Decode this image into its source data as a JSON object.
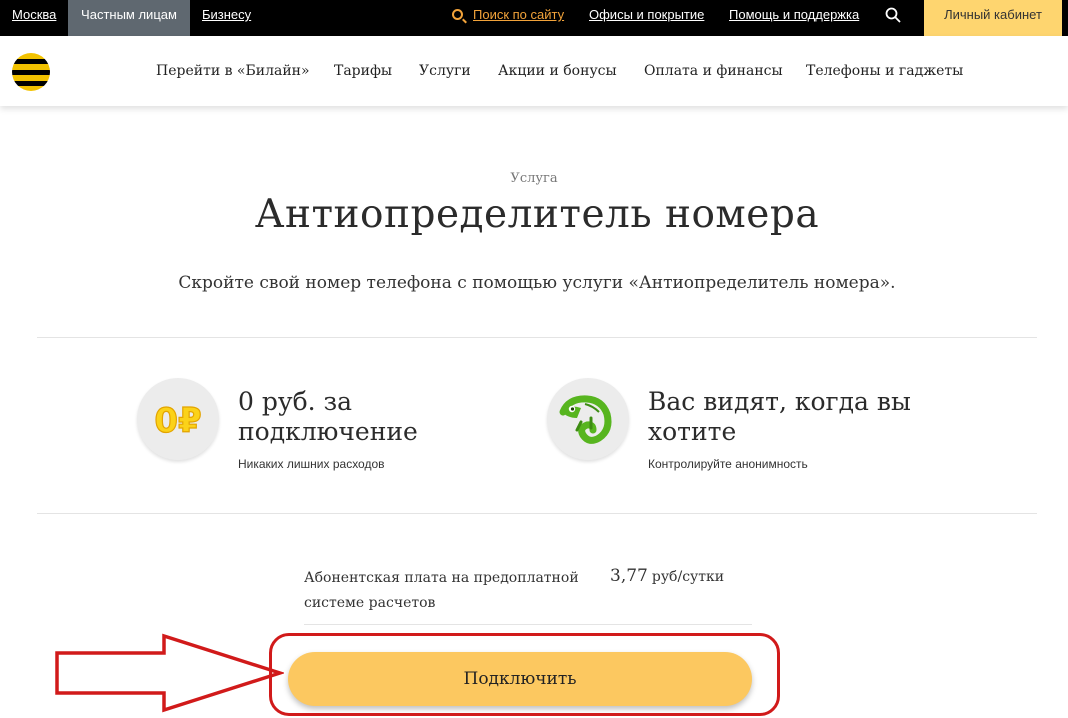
{
  "topbar": {
    "city": "Москва",
    "private": "Частным лицам",
    "business": "Бизнесу",
    "search": "Поиск по сайту",
    "offices": "Офисы и покрытие",
    "help": "Помощь и поддержка",
    "cabinet": "Личный кабинет"
  },
  "nav": {
    "items": [
      "Перейти в «Билайн»",
      "Тарифы",
      "Услуги",
      "Акции и бонусы",
      "Оплата и финансы",
      "Телефоны и гаджеты"
    ]
  },
  "hero": {
    "kicker": "Услуга",
    "title": "Антиопределитель номера",
    "subtitle": "Скройте свой номер телефона с помощью услуги «Антиопределитель номера»."
  },
  "features": [
    {
      "icon_text": "0₽",
      "icon": "zero-ruble-icon",
      "title": "0 руб. за подключение",
      "subtitle": "Никаких лишних расходов"
    },
    {
      "icon": "chameleon-icon",
      "title": "Вас видят, когда вы хотите",
      "subtitle": "Контролируйте анонимность"
    }
  ],
  "price": {
    "label": "Абонентская плата на предоплатной системе расчетов",
    "value": "3,77",
    "unit": "руб/сутки"
  },
  "button": {
    "label": "Подключить"
  },
  "colors": {
    "topbar_bg": "#000000",
    "topbar_active_bg": "#5f6870",
    "search_orange": "#f2a33a",
    "cabinet_bg": "#fed56f",
    "button_bg": "#fcc860",
    "highlight_red": "#d11a1a",
    "logo_yellow": "#f2c200"
  }
}
